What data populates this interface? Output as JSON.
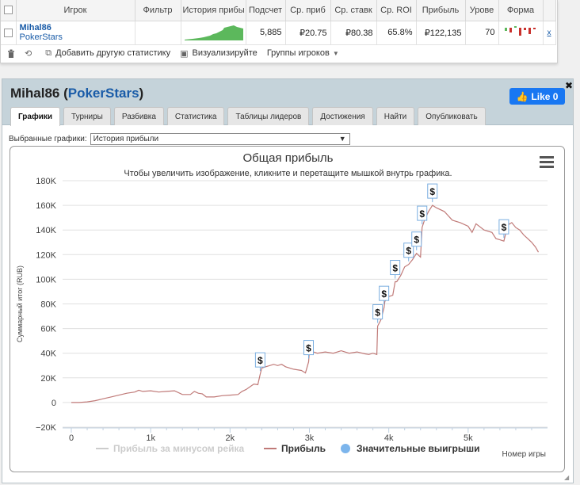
{
  "stats": {
    "headers": [
      "Игрок",
      "Фильтр",
      "История прибы",
      "Подсчет",
      "Ср. приб",
      "Ср. ставк",
      "Ср. ROI",
      "Прибыль",
      "Урове",
      "Форма"
    ],
    "player_name": "Mihal86",
    "player_site": "PokerStars",
    "count": "5,885",
    "avg_profit": "₽20.75",
    "avg_stake": "₽80.38",
    "roi": "65.8%",
    "profit": "₽122,135",
    "level": "70",
    "remove_label": "x"
  },
  "toolbar": {
    "add_stat": "Добавить другую статистику",
    "visualize": "Визуализируйте",
    "groups": "Группы игроков"
  },
  "panel": {
    "player_name": "Mihal86",
    "player_site": "PokerStars",
    "like_label": "Like 0",
    "tabs": [
      "Графики",
      "Турниры",
      "Разбивка",
      "Статистика",
      "Таблицы лидеров",
      "Достижения",
      "Найти",
      "Опубликовать"
    ],
    "active_tab": "Графики",
    "select_label": "Выбранные графики:",
    "select_value": "История прибыли"
  },
  "chart_data": {
    "type": "line",
    "title": "Общая прибыль",
    "subtitle": "Чтобы увеличить изображение, кликните и перетащите мышкой внутрь графика.",
    "ylabel": "Суммарный итог (RUB)",
    "xlabel": "Номер игры",
    "ylim": [
      -20000,
      180000
    ],
    "xlim": [
      0,
      5885
    ],
    "y_ticks": [
      -20000,
      0,
      20000,
      40000,
      60000,
      80000,
      100000,
      120000,
      140000,
      160000,
      180000
    ],
    "y_tick_labels": [
      "−20K",
      "0",
      "20K",
      "40K",
      "60K",
      "80K",
      "100K",
      "120K",
      "140K",
      "160K",
      "180K"
    ],
    "x_ticks": [
      0,
      1000,
      2000,
      3000,
      4000,
      5000
    ],
    "x_tick_labels": [
      "0",
      "1k",
      "2k",
      "3k",
      "4k",
      "5k"
    ],
    "grid": "horizontal",
    "legend": [
      "Прибыль за минусом рейка",
      "Прибыль",
      "Значительные выигрыши"
    ],
    "legend_placement": "bottom",
    "series": [
      {
        "name": "Прибыль",
        "color": "#c07a78",
        "x": [
          0,
          100,
          200,
          300,
          400,
          500,
          600,
          700,
          800,
          850,
          900,
          1000,
          1100,
          1200,
          1300,
          1400,
          1500,
          1550,
          1600,
          1650,
          1700,
          1800,
          1900,
          2000,
          2100,
          2150,
          2200,
          2300,
          2350,
          2380,
          2400,
          2450,
          2500,
          2550,
          2600,
          2650,
          2700,
          2800,
          2900,
          2950,
          2990,
          3000,
          3050,
          3100,
          3200,
          3300,
          3400,
          3500,
          3600,
          3700,
          3750,
          3800,
          3850,
          3860,
          3900,
          3940,
          3950,
          4000,
          4050,
          4080,
          4100,
          4150,
          4200,
          4250,
          4300,
          4350,
          4400,
          4420,
          4450,
          4500,
          4550,
          4600,
          4700,
          4800,
          4900,
          5000,
          5050,
          5100,
          5200,
          5300,
          5350,
          5400,
          5450,
          5500,
          5550,
          5600,
          5650,
          5700,
          5750,
          5800,
          5850,
          5885
        ],
        "y": [
          0,
          0,
          500,
          1500,
          3000,
          4500,
          6000,
          7500,
          8500,
          10000,
          9000,
          9500,
          8500,
          9000,
          9500,
          6500,
          6500,
          9000,
          7500,
          7000,
          4500,
          4500,
          5500,
          6000,
          6500,
          9000,
          10500,
          15000,
          14500,
          23000,
          28000,
          29000,
          30000,
          31000,
          30000,
          31000,
          29000,
          27000,
          26000,
          24000,
          33000,
          42000,
          41000,
          40000,
          41000,
          40000,
          42000,
          40000,
          41000,
          39500,
          39000,
          40000,
          39000,
          62000,
          67000,
          77000,
          82000,
          86000,
          87000,
          98000,
          98000,
          103000,
          110000,
          112000,
          116000,
          121000,
          118000,
          142000,
          148000,
          155000,
          160000,
          158000,
          155000,
          148000,
          146000,
          143000,
          138000,
          145000,
          140000,
          138000,
          133000,
          132000,
          131000,
          144000,
          146000,
          142000,
          140000,
          136000,
          133000,
          130000,
          126000,
          122000
        ]
      }
    ],
    "big_wins": [
      2380,
      2990,
      3860,
      3940,
      4080,
      4250,
      4350,
      4420,
      4550,
      5450
    ]
  }
}
